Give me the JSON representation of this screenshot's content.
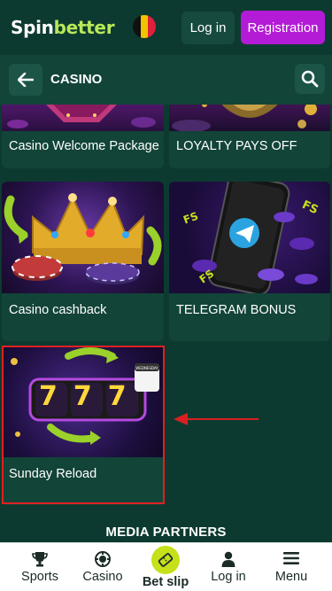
{
  "header": {
    "logo_part1": "Spin",
    "logo_part2": "better",
    "login_label": "Log in",
    "register_label": "Registration"
  },
  "subheader": {
    "title": "CASINO"
  },
  "promotions": [
    {
      "title": "Casino Welcome Package"
    },
    {
      "title": "LOYALTY PAYS OFF"
    },
    {
      "title": "Casino cashback"
    },
    {
      "title": "TELEGRAM BONUS"
    },
    {
      "title": "Sunday Reload"
    }
  ],
  "promo_art": {
    "slot_digits": "777",
    "calendar_day": "WEDNESDAY",
    "fs_badge": "FS"
  },
  "section_heading": "MEDIA PARTNERS",
  "bottom_nav": [
    {
      "label": "Sports",
      "icon": "trophy-icon"
    },
    {
      "label": "Casino",
      "icon": "casino-chip-icon"
    },
    {
      "label": "Bet slip",
      "icon": "ticket-icon"
    },
    {
      "label": "Log in",
      "icon": "user-icon"
    },
    {
      "label": "Menu",
      "icon": "hamburger-icon"
    }
  ],
  "colors": {
    "background": "#0d3a30",
    "card": "#124438",
    "registration_button": "#b41bd6",
    "logo_accent": "#b8e85a",
    "bet_slip_accent": "#c6e01a",
    "highlight": "#e02020"
  }
}
